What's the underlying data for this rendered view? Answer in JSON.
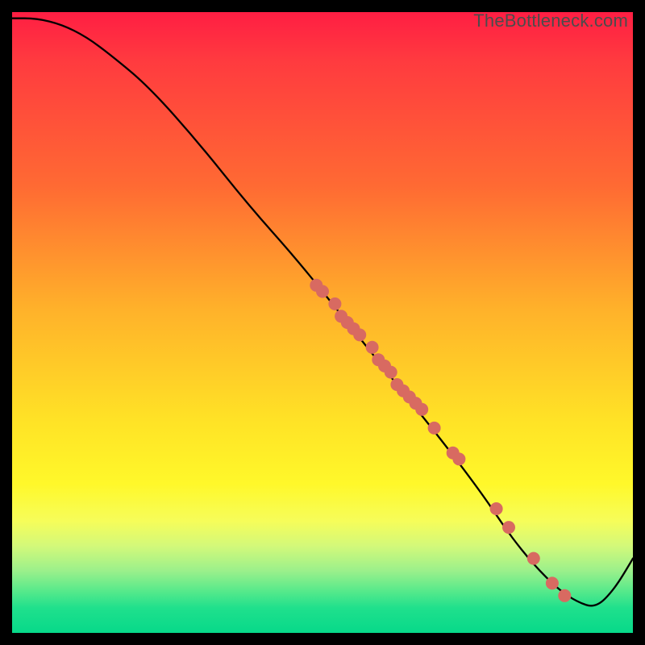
{
  "watermark": "TheBottleneck.com",
  "colors": {
    "frame": "#000000",
    "curve": "#000000",
    "dot": "#d86a61",
    "gradient_top": "#ff1e43",
    "gradient_mid": "#ffe326",
    "gradient_bottom": "#07d98a"
  },
  "chart_data": {
    "type": "line",
    "title": "",
    "xlabel": "",
    "ylabel": "",
    "xlim": [
      0,
      100
    ],
    "ylim": [
      0,
      100
    ],
    "note": "Axes are unlabeled; x/y values normalized to 0–100 (percent of plot width/height from bottom-left).",
    "series": [
      {
        "name": "bottleneck-curve",
        "x": [
          0,
          4,
          8,
          12,
          16,
          22,
          30,
          38,
          46,
          54,
          62,
          70,
          76,
          80,
          84,
          88,
          91,
          94,
          97,
          100
        ],
        "y": [
          99,
          99,
          98,
          96,
          93,
          88,
          79,
          69,
          60,
          50,
          40,
          30,
          22,
          16,
          11,
          7,
          5,
          4,
          7,
          12
        ]
      }
    ],
    "markers": {
      "name": "highlighted-points",
      "x": [
        49,
        50,
        52,
        53,
        54,
        55,
        56,
        58,
        59,
        60,
        61,
        62,
        63,
        64,
        65,
        66,
        68,
        71,
        72,
        78,
        80,
        84,
        87,
        89
      ],
      "y": [
        56,
        55,
        53,
        51,
        50,
        49,
        48,
        46,
        44,
        43,
        42,
        40,
        39,
        38,
        37,
        36,
        33,
        29,
        28,
        20,
        17,
        12,
        8,
        6
      ]
    }
  }
}
